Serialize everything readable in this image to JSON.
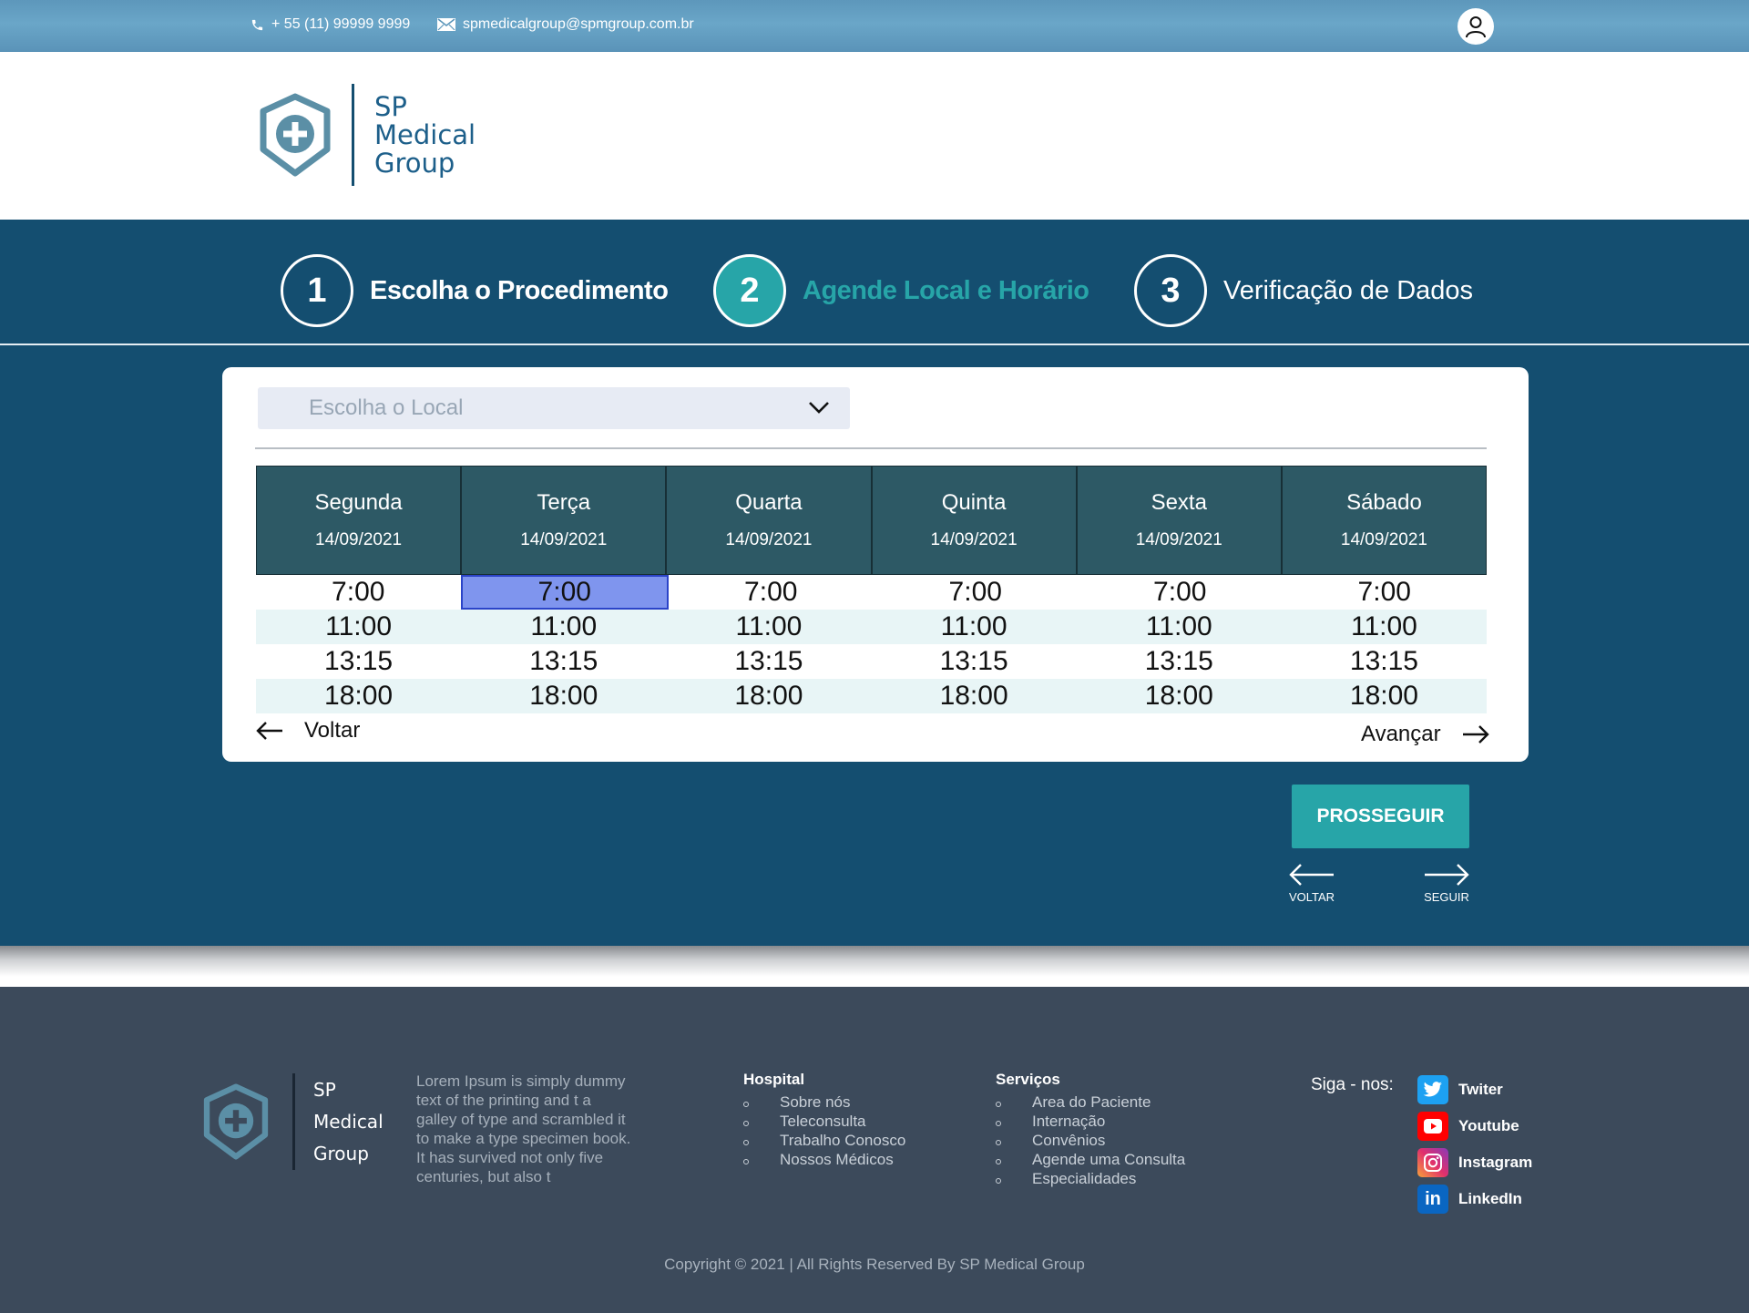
{
  "topbar": {
    "phone": "+ 55 (11) 99999 9999",
    "email": "spmedicalgroup@spmgroup.com.br"
  },
  "brand": {
    "line1": "SP",
    "line2": "Medical",
    "line3": "Group",
    "color": "#1d5f8a"
  },
  "steps": [
    {
      "number": "1",
      "label": "Escolha o Procedimento",
      "state": "done"
    },
    {
      "number": "2",
      "label": "Agende Local e Horário",
      "state": "active"
    },
    {
      "number": "3",
      "label": "Verificação de Dados",
      "state": "pending"
    }
  ],
  "location_select": {
    "placeholder": "Escolha o Local"
  },
  "schedule": {
    "days": [
      {
        "name": "Segunda",
        "date": "14/09/2021"
      },
      {
        "name": "Terça",
        "date": "14/09/2021"
      },
      {
        "name": "Quarta",
        "date": "14/09/2021"
      },
      {
        "name": "Quinta",
        "date": "14/09/2021"
      },
      {
        "name": "Sexta",
        "date": "14/09/2021"
      },
      {
        "name": "Sábado",
        "date": "14/09/2021"
      }
    ],
    "times": [
      "7:00",
      "11:00",
      "13:15",
      "18:00"
    ],
    "selected": {
      "day": "Terça",
      "time": "7:00"
    }
  },
  "card_nav": {
    "back_label": "Voltar",
    "forward_label": "Avançar"
  },
  "actions": {
    "proceed_label": "PROSSEGUIR",
    "back_label": "VOLTAR",
    "next_label": "SEGUIR"
  },
  "footer": {
    "brand": {
      "line1": "SP",
      "line2": "Medical",
      "line3": "Group"
    },
    "about": "Lorem Ipsum is simply dummy text of the printing and t a galley of type and scrambled it to make a type specimen book. It has survived not only five centuries, but also t",
    "hospital": {
      "title": "Hospital",
      "items": [
        "Sobre nós",
        "Teleconsulta",
        "Trabalho Conosco",
        "Nossos Médicos"
      ]
    },
    "services": {
      "title": "Serviços",
      "items": [
        "Area do Paciente",
        "Internação",
        "Convênios",
        "Agende uma Consulta",
        "Especialidades"
      ]
    },
    "follow_label": "Siga - nos:",
    "social": [
      {
        "name": "Twiter",
        "icon": "twitter-icon",
        "color": "#1da1f2"
      },
      {
        "name": "Youtube",
        "icon": "youtube-icon",
        "color": "#ff0000"
      },
      {
        "name": "Instagram",
        "icon": "instagram-icon",
        "color": "#d6249f"
      },
      {
        "name": "LinkedIn",
        "icon": "linkedin-icon",
        "color": "#0a66c2"
      }
    ],
    "copyright": "Copyright © 2021 | All Rights Reserved By SP Medical Group"
  },
  "colors": {
    "primary": "#144e70",
    "accent": "#27a5a8",
    "table_header": "#2d5965",
    "selected_slot": "#7f95ee",
    "footer_bg": "#3c4a5b"
  }
}
